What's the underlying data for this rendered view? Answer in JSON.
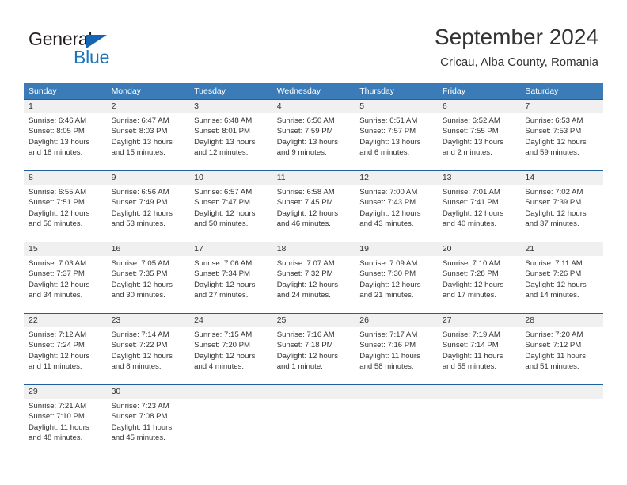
{
  "header": {
    "logo": {
      "word1": "General",
      "word2": "Blue",
      "triangle_color": "#1665b0",
      "word2_color": "#1b75bb"
    },
    "title": "September 2024",
    "subtitle": "Cricau, Alba County, Romania"
  },
  "calendar": {
    "header_bg": "#3b7cb8",
    "rule_color": "#1f5fa0",
    "number_band_bg": "#f0f0f0",
    "day_names": [
      "Sunday",
      "Monday",
      "Tuesday",
      "Wednesday",
      "Thursday",
      "Friday",
      "Saturday"
    ],
    "weeks": [
      [
        {
          "day": "1",
          "sunrise": "Sunrise: 6:46 AM",
          "sunset": "Sunset: 8:05 PM",
          "daylight1": "Daylight: 13 hours",
          "daylight2": "and 18 minutes."
        },
        {
          "day": "2",
          "sunrise": "Sunrise: 6:47 AM",
          "sunset": "Sunset: 8:03 PM",
          "daylight1": "Daylight: 13 hours",
          "daylight2": "and 15 minutes."
        },
        {
          "day": "3",
          "sunrise": "Sunrise: 6:48 AM",
          "sunset": "Sunset: 8:01 PM",
          "daylight1": "Daylight: 13 hours",
          "daylight2": "and 12 minutes."
        },
        {
          "day": "4",
          "sunrise": "Sunrise: 6:50 AM",
          "sunset": "Sunset: 7:59 PM",
          "daylight1": "Daylight: 13 hours",
          "daylight2": "and 9 minutes."
        },
        {
          "day": "5",
          "sunrise": "Sunrise: 6:51 AM",
          "sunset": "Sunset: 7:57 PM",
          "daylight1": "Daylight: 13 hours",
          "daylight2": "and 6 minutes."
        },
        {
          "day": "6",
          "sunrise": "Sunrise: 6:52 AM",
          "sunset": "Sunset: 7:55 PM",
          "daylight1": "Daylight: 13 hours",
          "daylight2": "and 2 minutes."
        },
        {
          "day": "7",
          "sunrise": "Sunrise: 6:53 AM",
          "sunset": "Sunset: 7:53 PM",
          "daylight1": "Daylight: 12 hours",
          "daylight2": "and 59 minutes."
        }
      ],
      [
        {
          "day": "8",
          "sunrise": "Sunrise: 6:55 AM",
          "sunset": "Sunset: 7:51 PM",
          "daylight1": "Daylight: 12 hours",
          "daylight2": "and 56 minutes."
        },
        {
          "day": "9",
          "sunrise": "Sunrise: 6:56 AM",
          "sunset": "Sunset: 7:49 PM",
          "daylight1": "Daylight: 12 hours",
          "daylight2": "and 53 minutes."
        },
        {
          "day": "10",
          "sunrise": "Sunrise: 6:57 AM",
          "sunset": "Sunset: 7:47 PM",
          "daylight1": "Daylight: 12 hours",
          "daylight2": "and 50 minutes."
        },
        {
          "day": "11",
          "sunrise": "Sunrise: 6:58 AM",
          "sunset": "Sunset: 7:45 PM",
          "daylight1": "Daylight: 12 hours",
          "daylight2": "and 46 minutes."
        },
        {
          "day": "12",
          "sunrise": "Sunrise: 7:00 AM",
          "sunset": "Sunset: 7:43 PM",
          "daylight1": "Daylight: 12 hours",
          "daylight2": "and 43 minutes."
        },
        {
          "day": "13",
          "sunrise": "Sunrise: 7:01 AM",
          "sunset": "Sunset: 7:41 PM",
          "daylight1": "Daylight: 12 hours",
          "daylight2": "and 40 minutes."
        },
        {
          "day": "14",
          "sunrise": "Sunrise: 7:02 AM",
          "sunset": "Sunset: 7:39 PM",
          "daylight1": "Daylight: 12 hours",
          "daylight2": "and 37 minutes."
        }
      ],
      [
        {
          "day": "15",
          "sunrise": "Sunrise: 7:03 AM",
          "sunset": "Sunset: 7:37 PM",
          "daylight1": "Daylight: 12 hours",
          "daylight2": "and 34 minutes."
        },
        {
          "day": "16",
          "sunrise": "Sunrise: 7:05 AM",
          "sunset": "Sunset: 7:35 PM",
          "daylight1": "Daylight: 12 hours",
          "daylight2": "and 30 minutes."
        },
        {
          "day": "17",
          "sunrise": "Sunrise: 7:06 AM",
          "sunset": "Sunset: 7:34 PM",
          "daylight1": "Daylight: 12 hours",
          "daylight2": "and 27 minutes."
        },
        {
          "day": "18",
          "sunrise": "Sunrise: 7:07 AM",
          "sunset": "Sunset: 7:32 PM",
          "daylight1": "Daylight: 12 hours",
          "daylight2": "and 24 minutes."
        },
        {
          "day": "19",
          "sunrise": "Sunrise: 7:09 AM",
          "sunset": "Sunset: 7:30 PM",
          "daylight1": "Daylight: 12 hours",
          "daylight2": "and 21 minutes."
        },
        {
          "day": "20",
          "sunrise": "Sunrise: 7:10 AM",
          "sunset": "Sunset: 7:28 PM",
          "daylight1": "Daylight: 12 hours",
          "daylight2": "and 17 minutes."
        },
        {
          "day": "21",
          "sunrise": "Sunrise: 7:11 AM",
          "sunset": "Sunset: 7:26 PM",
          "daylight1": "Daylight: 12 hours",
          "daylight2": "and 14 minutes."
        }
      ],
      [
        {
          "day": "22",
          "sunrise": "Sunrise: 7:12 AM",
          "sunset": "Sunset: 7:24 PM",
          "daylight1": "Daylight: 12 hours",
          "daylight2": "and 11 minutes."
        },
        {
          "day": "23",
          "sunrise": "Sunrise: 7:14 AM",
          "sunset": "Sunset: 7:22 PM",
          "daylight1": "Daylight: 12 hours",
          "daylight2": "and 8 minutes."
        },
        {
          "day": "24",
          "sunrise": "Sunrise: 7:15 AM",
          "sunset": "Sunset: 7:20 PM",
          "daylight1": "Daylight: 12 hours",
          "daylight2": "and 4 minutes."
        },
        {
          "day": "25",
          "sunrise": "Sunrise: 7:16 AM",
          "sunset": "Sunset: 7:18 PM",
          "daylight1": "Daylight: 12 hours",
          "daylight2": "and 1 minute."
        },
        {
          "day": "26",
          "sunrise": "Sunrise: 7:17 AM",
          "sunset": "Sunset: 7:16 PM",
          "daylight1": "Daylight: 11 hours",
          "daylight2": "and 58 minutes."
        },
        {
          "day": "27",
          "sunrise": "Sunrise: 7:19 AM",
          "sunset": "Sunset: 7:14 PM",
          "daylight1": "Daylight: 11 hours",
          "daylight2": "and 55 minutes."
        },
        {
          "day": "28",
          "sunrise": "Sunrise: 7:20 AM",
          "sunset": "Sunset: 7:12 PM",
          "daylight1": "Daylight: 11 hours",
          "daylight2": "and 51 minutes."
        }
      ],
      [
        {
          "day": "29",
          "sunrise": "Sunrise: 7:21 AM",
          "sunset": "Sunset: 7:10 PM",
          "daylight1": "Daylight: 11 hours",
          "daylight2": "and 48 minutes."
        },
        {
          "day": "30",
          "sunrise": "Sunrise: 7:23 AM",
          "sunset": "Sunset: 7:08 PM",
          "daylight1": "Daylight: 11 hours",
          "daylight2": "and 45 minutes."
        },
        {
          "day": "",
          "sunrise": "",
          "sunset": "",
          "daylight1": "",
          "daylight2": ""
        },
        {
          "day": "",
          "sunrise": "",
          "sunset": "",
          "daylight1": "",
          "daylight2": ""
        },
        {
          "day": "",
          "sunrise": "",
          "sunset": "",
          "daylight1": "",
          "daylight2": ""
        },
        {
          "day": "",
          "sunrise": "",
          "sunset": "",
          "daylight1": "",
          "daylight2": ""
        },
        {
          "day": "",
          "sunrise": "",
          "sunset": "",
          "daylight1": "",
          "daylight2": ""
        }
      ]
    ]
  }
}
